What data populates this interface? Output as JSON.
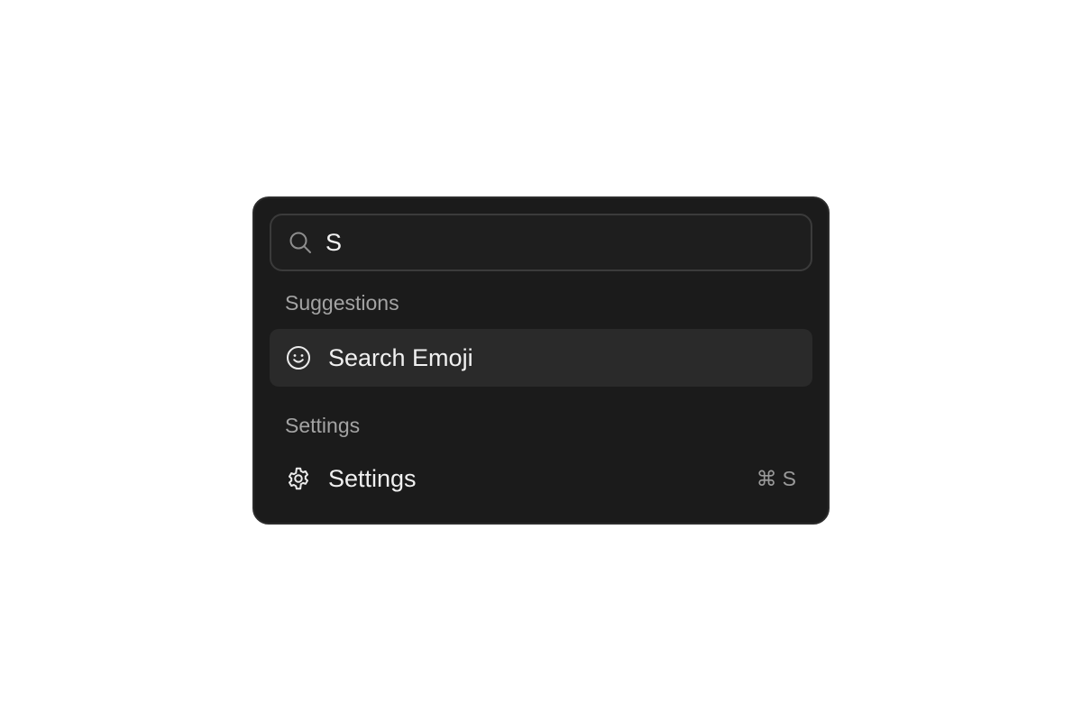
{
  "search": {
    "value": "S",
    "icon": "search-icon"
  },
  "groups": [
    {
      "heading": "Suggestions",
      "items": [
        {
          "label": "Search Emoji",
          "icon": "smiley-icon",
          "active": true
        }
      ]
    },
    {
      "heading": "Settings",
      "items": [
        {
          "label": "Settings",
          "icon": "gear-icon",
          "shortcut_symbol": "⌘",
          "shortcut_key": "S"
        }
      ]
    }
  ],
  "colors": {
    "panel_bg": "#1b1b1b",
    "active_item_bg": "#2a2a2a",
    "heading_text": "#a3a3a3",
    "item_text": "#f0f0f0"
  }
}
